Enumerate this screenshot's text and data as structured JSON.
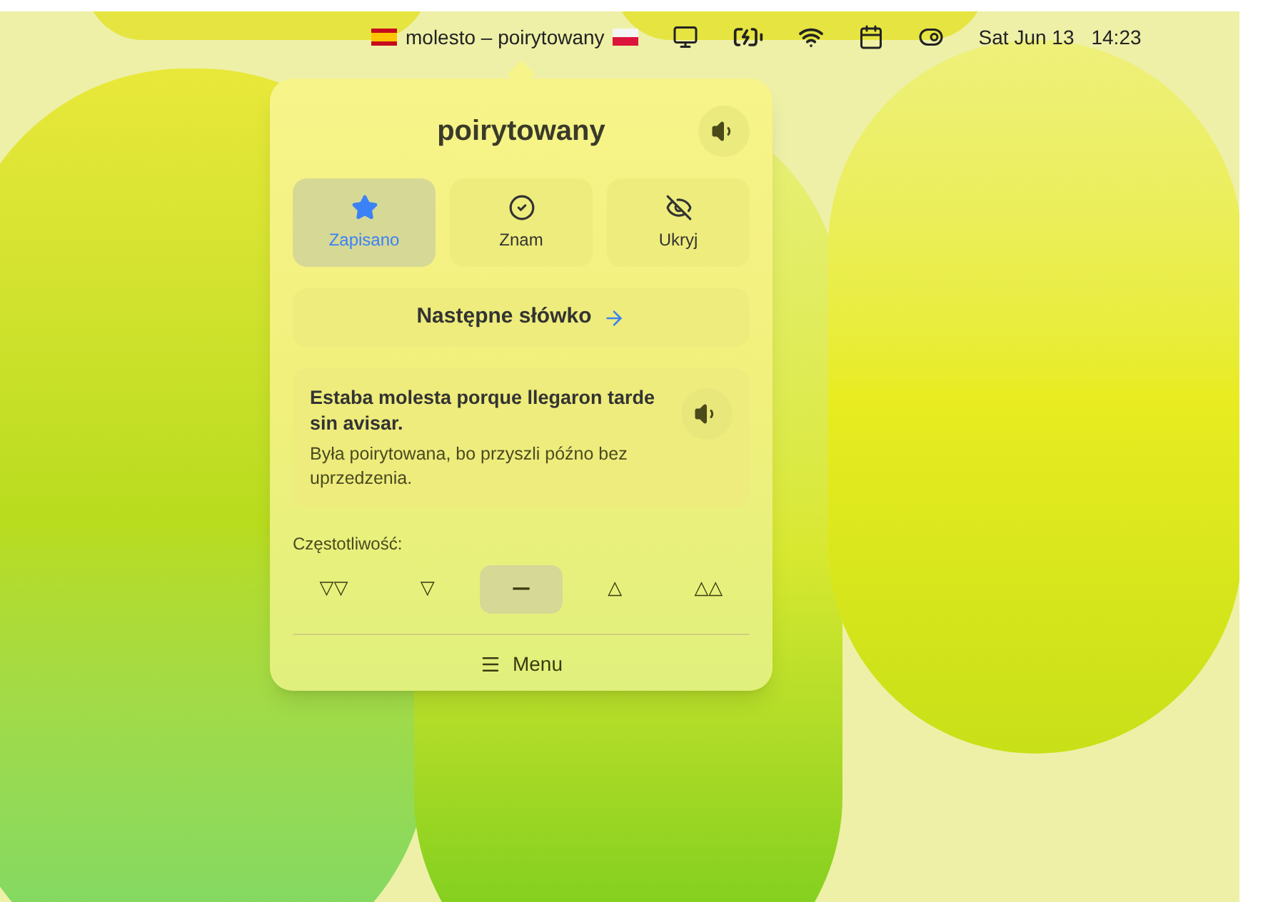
{
  "menu_bar": {
    "word_pair": "molesto – poirytowany",
    "date": "Sat Jun 13",
    "time": "14:23"
  },
  "popover": {
    "word": "poirytowany",
    "actions": [
      {
        "kind": "star",
        "label": "Zapisano",
        "selected": true
      },
      {
        "kind": "check",
        "label": "Znam",
        "selected": false
      },
      {
        "kind": "hide",
        "label": "Ukryj",
        "selected": false
      }
    ],
    "next_button": "Następne słówko",
    "example": {
      "sentence": "Estaba molesta porque llegaron tarde sin avisar.",
      "translation": "Była poirytowana, bo przyszli późno bez uprzedzenia."
    },
    "frequency_label": "Częstotliwość:",
    "frequency_options": [
      {
        "symbol": "▽▽",
        "selected": false
      },
      {
        "symbol": "▽",
        "selected": false
      },
      {
        "symbol": "—",
        "selected": true
      },
      {
        "symbol": "△",
        "selected": false
      },
      {
        "symbol": "△△",
        "selected": false
      }
    ],
    "menu_button": "Menu"
  }
}
